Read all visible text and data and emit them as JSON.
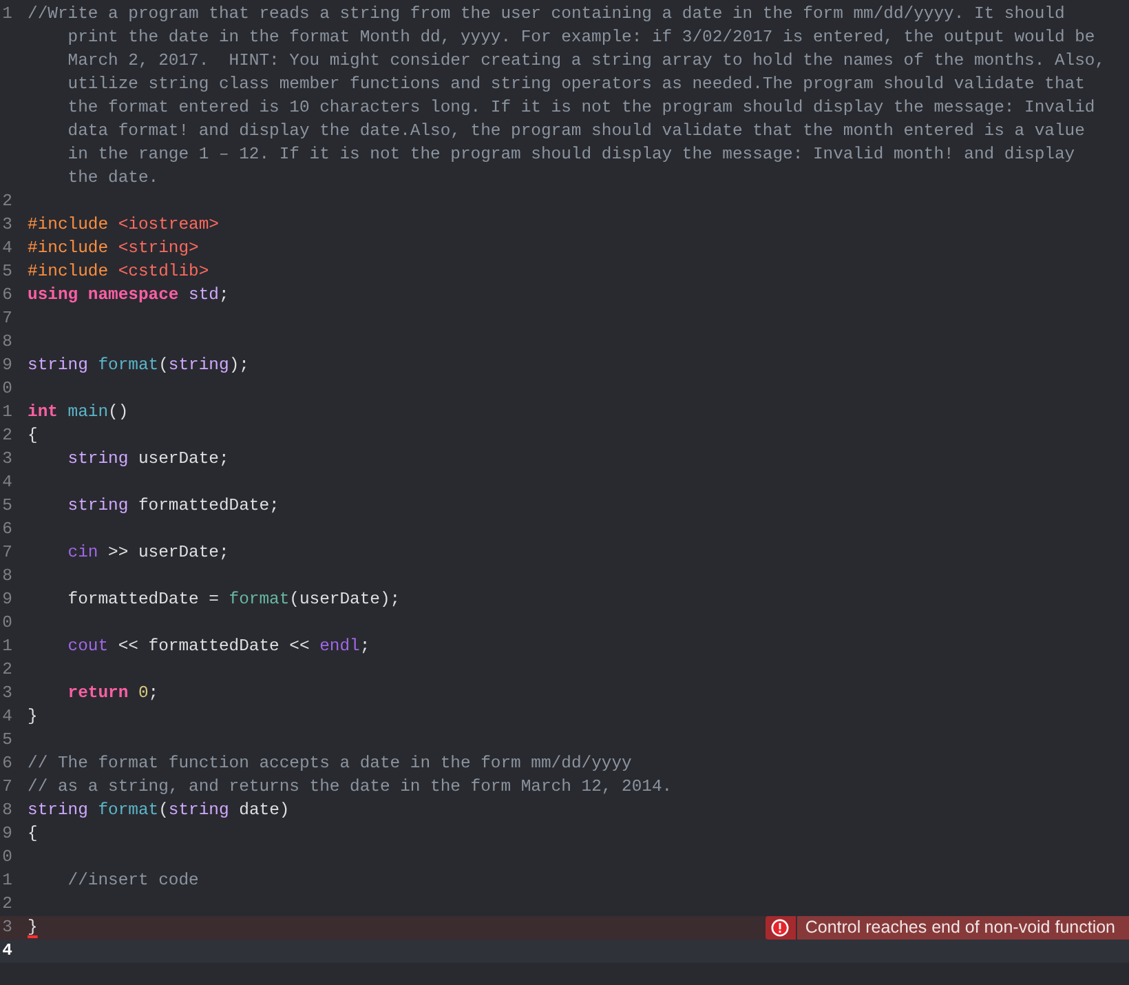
{
  "editor": {
    "lines": [
      {
        "number": "1",
        "current": false,
        "error": false,
        "tokens": [
          {
            "kind": "comment",
            "text": "//Write a program that reads a string from the user containing a date in the form mm/dd/yyyy. It should"
          }
        ],
        "wrapped": [
          "print the date in the format Month dd, yyyy. For example: if 3/02/2017 is entered, the output would be",
          "March 2, 2017.  HINT: You might consider creating a string array to hold the names of the months. Also,",
          "utilize string class member functions and string operators as needed.The program should validate that",
          "the format entered is 10 characters long. If it is not the program should display the message: Invalid",
          "data format! and display the date.Also, the program should validate that the month entered is a value",
          "in the range 1 – 12. If it is not the program should display the message: Invalid month! and display",
          "the date."
        ]
      },
      {
        "number": "2",
        "current": false,
        "error": false
      },
      {
        "number": "3",
        "current": false,
        "error": false,
        "tokens": [
          {
            "kind": "preproc",
            "text": "#include"
          },
          {
            "kind": "path",
            "text": " <iostream>"
          }
        ]
      },
      {
        "number": "4",
        "current": false,
        "error": false,
        "tokens": [
          {
            "kind": "preproc",
            "text": "#include"
          },
          {
            "kind": "path",
            "text": " <string>"
          }
        ]
      },
      {
        "number": "5",
        "current": false,
        "error": false,
        "tokens": [
          {
            "kind": "preproc",
            "text": "#include"
          },
          {
            "kind": "path",
            "text": " <cstdlib>"
          }
        ]
      },
      {
        "number": "6",
        "current": false,
        "error": false,
        "tokens": [
          {
            "kind": "keyword",
            "text": "using namespace"
          },
          {
            "kind": "type",
            "text": " std"
          },
          {
            "kind": "plain",
            "text": ";"
          }
        ]
      },
      {
        "number": "7",
        "current": false,
        "error": false
      },
      {
        "number": "8",
        "current": false,
        "error": false
      },
      {
        "number": "9",
        "current": false,
        "error": false,
        "tokens": [
          {
            "kind": "type",
            "text": "string"
          },
          {
            "kind": "function",
            "text": " format"
          },
          {
            "kind": "plain",
            "text": "("
          },
          {
            "kind": "type",
            "text": "string"
          },
          {
            "kind": "plain",
            "text": ");"
          }
        ]
      },
      {
        "number": "0",
        "current": false,
        "error": false
      },
      {
        "number": "1",
        "current": false,
        "error": false,
        "tokens": [
          {
            "kind": "keyword",
            "text": "int"
          },
          {
            "kind": "function",
            "text": " main"
          },
          {
            "kind": "plain",
            "text": "()"
          }
        ]
      },
      {
        "number": "2",
        "current": false,
        "error": false,
        "tokens": [
          {
            "kind": "plain",
            "text": "{"
          }
        ]
      },
      {
        "number": "3",
        "current": false,
        "error": false,
        "tokens": [
          {
            "kind": "type",
            "text": "    string"
          },
          {
            "kind": "plain",
            "text": " userDate;"
          }
        ]
      },
      {
        "number": "4",
        "current": false,
        "error": false
      },
      {
        "number": "5",
        "current": false,
        "error": false,
        "tokens": [
          {
            "kind": "type",
            "text": "    string"
          },
          {
            "kind": "plain",
            "text": " formattedDate;"
          }
        ]
      },
      {
        "number": "6",
        "current": false,
        "error": false
      },
      {
        "number": "7",
        "current": false,
        "error": false,
        "tokens": [
          {
            "kind": "stream",
            "text": "    cin"
          },
          {
            "kind": "plain",
            "text": " >> userDate;"
          }
        ]
      },
      {
        "number": "8",
        "current": false,
        "error": false
      },
      {
        "number": "9",
        "current": false,
        "error": false,
        "tokens": [
          {
            "kind": "plain",
            "text": "    formattedDate = "
          },
          {
            "kind": "call",
            "text": "format"
          },
          {
            "kind": "plain",
            "text": "(userDate);"
          }
        ]
      },
      {
        "number": "0",
        "current": false,
        "error": false
      },
      {
        "number": "1",
        "current": false,
        "error": false,
        "tokens": [
          {
            "kind": "stream",
            "text": "    cout"
          },
          {
            "kind": "plain",
            "text": " << formattedDate << "
          },
          {
            "kind": "stream",
            "text": "endl"
          },
          {
            "kind": "plain",
            "text": ";"
          }
        ]
      },
      {
        "number": "2",
        "current": false,
        "error": false
      },
      {
        "number": "3",
        "current": false,
        "error": false,
        "tokens": [
          {
            "kind": "keyword",
            "text": "    return"
          },
          {
            "kind": "number",
            "text": " 0"
          },
          {
            "kind": "plain",
            "text": ";"
          }
        ]
      },
      {
        "number": "4",
        "current": false,
        "error": false,
        "tokens": [
          {
            "kind": "plain",
            "text": "}"
          }
        ]
      },
      {
        "number": "5",
        "current": false,
        "error": false
      },
      {
        "number": "6",
        "current": false,
        "error": false,
        "tokens": [
          {
            "kind": "comment",
            "text": "// The format function accepts a date in the form mm/dd/yyyy"
          }
        ]
      },
      {
        "number": "7",
        "current": false,
        "error": false,
        "tokens": [
          {
            "kind": "comment",
            "text": "// as a string, and returns the date in the form March 12, 2014."
          }
        ]
      },
      {
        "number": "8",
        "current": false,
        "error": false,
        "tokens": [
          {
            "kind": "type",
            "text": "string"
          },
          {
            "kind": "function",
            "text": " format"
          },
          {
            "kind": "plain",
            "text": "("
          },
          {
            "kind": "type",
            "text": "string"
          },
          {
            "kind": "plain",
            "text": " date)"
          }
        ]
      },
      {
        "number": "9",
        "current": false,
        "error": false,
        "tokens": [
          {
            "kind": "plain",
            "text": "{"
          }
        ]
      },
      {
        "number": "0",
        "current": false,
        "error": false
      },
      {
        "number": "1",
        "current": false,
        "error": false,
        "tokens": [
          {
            "kind": "comment",
            "text": "    //insert code"
          }
        ]
      },
      {
        "number": "2",
        "current": false,
        "error": false
      },
      {
        "number": "3",
        "current": false,
        "error": true,
        "tokens": [
          {
            "kind": "plain",
            "text": "}",
            "flagged": true
          }
        ],
        "issue": {
          "message": "Control reaches end of non-void function"
        }
      },
      {
        "number": "4",
        "current": true,
        "error": false
      }
    ]
  }
}
